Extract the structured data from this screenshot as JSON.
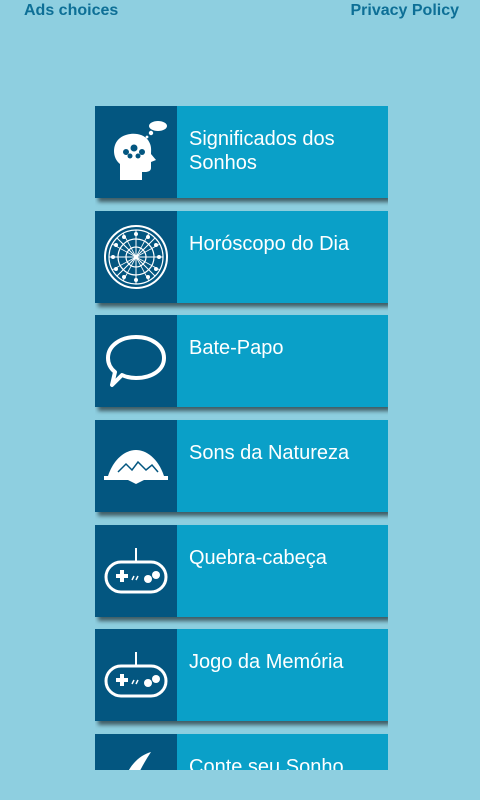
{
  "header": {
    "ads_choices": "Ads choices",
    "privacy_policy": "Privacy Policy"
  },
  "menu": {
    "items": [
      {
        "label": "Significados dos Sonhos",
        "icon": "dreaming-head-icon"
      },
      {
        "label": "Horóscopo do Dia",
        "icon": "zodiac-wheel-icon"
      },
      {
        "label": "Bate-Papo",
        "icon": "chat-bubble-icon"
      },
      {
        "label": "Sons da Natureza",
        "icon": "mountain-icon"
      },
      {
        "label": "Quebra-cabeça",
        "icon": "gamepad-icon"
      },
      {
        "label": "Jogo da Memória",
        "icon": "gamepad-icon"
      },
      {
        "label": "Conte seu Sonho",
        "icon": "feather-icon"
      }
    ]
  },
  "colors": {
    "background": "#8ecfe0",
    "header_link": "#0d6f96",
    "item_bg": "#0aa0c8",
    "icon_bg": "#035680",
    "text": "#ffffff"
  }
}
